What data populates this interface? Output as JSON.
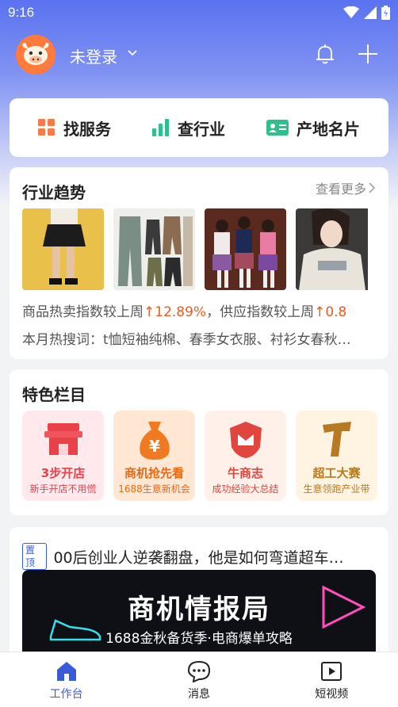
{
  "status_bar": {
    "time": "9:16"
  },
  "header": {
    "login_label": "未登录"
  },
  "quick_nav": [
    {
      "label": "找服务",
      "icon": "grid-icon",
      "color": "#f47b4a"
    },
    {
      "label": "查行业",
      "icon": "bar-chart-icon",
      "color": "#2fbf8f"
    },
    {
      "label": "产地名片",
      "icon": "id-card-icon",
      "color": "#2fbf8f"
    }
  ],
  "trend": {
    "title": "行业趋势",
    "more": "查看更多",
    "line1_a": "商品热卖指数较上周",
    "line1_b": "12.89%",
    "line1_c": "，供应指数较上周",
    "line1_d": "0.8",
    "line2": "本月热搜词：t恤短袖纯棉、春季女衣服、衬衫女春秋…"
  },
  "featured": {
    "title": "特色栏目",
    "items": [
      {
        "title": "3步开店",
        "subtitle": "新手开店不用慌",
        "color": "#e8414a",
        "bg": "#ffe9ec"
      },
      {
        "title": "商机抢先看",
        "subtitle": "1688生意新机会",
        "color": "#e36a16",
        "bg": "#ffe7d4"
      },
      {
        "title": "牛商志",
        "subtitle": "成功经验大总结",
        "color": "#e0463d",
        "bg": "#fff0ea"
      },
      {
        "title": "超工大赛",
        "subtitle": "生意领跑产业带",
        "color": "#b77a22",
        "bg": "#fff3e2"
      }
    ]
  },
  "news": {
    "badge": "置顶",
    "title": "00后创业人逆袭翻盘，他是如何弯道超车…",
    "banner_title": "商机情报局",
    "banner_subtitle": "1688金秋备货季·电商爆单攻略"
  },
  "tabs": [
    {
      "label": "工作台",
      "icon": "home-icon",
      "active": true
    },
    {
      "label": "消息",
      "icon": "message-icon",
      "active": false
    },
    {
      "label": "短视频",
      "icon": "video-icon",
      "active": false
    }
  ],
  "colors": {
    "accent": "#3a5bd9",
    "up_arrow": "#f05a1a"
  }
}
